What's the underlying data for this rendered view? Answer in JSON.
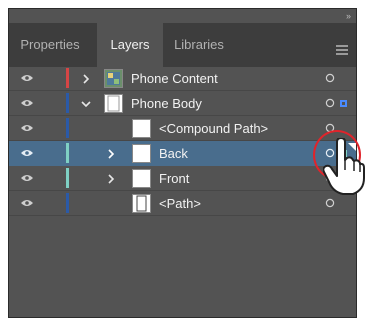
{
  "tabs": [
    {
      "label": "Properties",
      "active": false
    },
    {
      "label": "Layers",
      "active": true
    },
    {
      "label": "Libraries",
      "active": false
    }
  ],
  "panel_icons": {
    "collapse": "double-chevron-right-icon",
    "menu": "panel-menu-icon"
  },
  "layers": [
    {
      "name": "Phone Content",
      "color": "#d64545",
      "expand": "collapsed",
      "selected": false,
      "thumbnail": "phone-content-thumbnail"
    },
    {
      "name": "Phone Body",
      "color": "#2b5aa8",
      "expand": "expanded",
      "selected": false,
      "thumbnail": "phone-body-thumbnail"
    },
    {
      "name": "<Compound Path>",
      "color": "#2b5aa8",
      "expand": "none",
      "selected": false,
      "thumbnail": "compound-path-thumbnail"
    },
    {
      "name": "Back",
      "color": "#7fd0c4",
      "expand": "collapsed",
      "selected": true,
      "thumbnail": "back-thumbnail"
    },
    {
      "name": "Front",
      "color": "#7fd0c4",
      "expand": "collapsed",
      "selected": false,
      "thumbnail": "front-thumbnail"
    },
    {
      "name": "<Path>",
      "color": "#2b5aa8",
      "expand": "none",
      "selected": false,
      "thumbnail": "path-thumbnail"
    }
  ],
  "selection_indicator_color": "#4a8bff",
  "highlight_color": "#e0242b"
}
